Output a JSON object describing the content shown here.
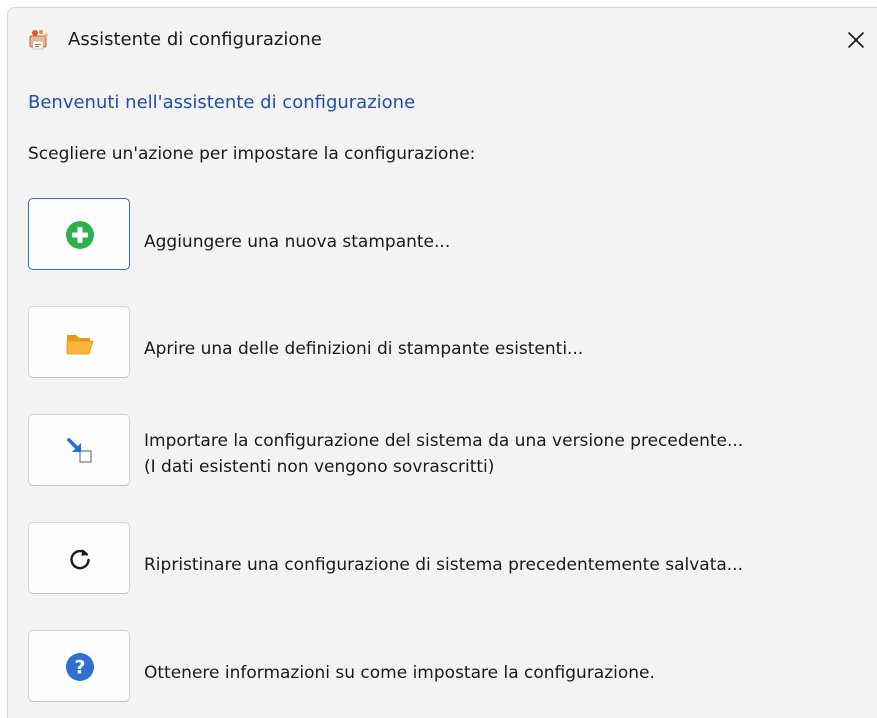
{
  "window": {
    "title": "Assistente di configurazione",
    "app_icon": "printer-wizard-icon",
    "close_icon": "close-icon"
  },
  "content": {
    "welcome": "Benvenuti nell'assistente di configurazione",
    "intro": "Scegliere un'azione per impostare la configurazione:"
  },
  "actions": [
    {
      "icon": "add-circle-icon",
      "label": "Aggiungere una nuova stampante...",
      "focused": true
    },
    {
      "icon": "open-folder-icon",
      "label": "Aprire una delle definizioni di stampante esistenti..."
    },
    {
      "icon": "import-icon",
      "label": "Importare la configurazione del sistema da una versione precedente...",
      "note": "(I dati esistenti non vengono sovrascritti)"
    },
    {
      "icon": "restore-icon",
      "label": "Ripristinare una configurazione di sistema precedentemente salvata..."
    },
    {
      "icon": "help-icon",
      "label": "Ottenere informazioni su come impostare la configurazione."
    }
  ],
  "colors": {
    "accent": "#1f4fa8",
    "add_green": "#2bb24c",
    "folder_orange": "#f5a623",
    "import_blue": "#1f6fd6",
    "help_blue": "#2f6fd1",
    "focus_border": "#2f6fd1"
  }
}
